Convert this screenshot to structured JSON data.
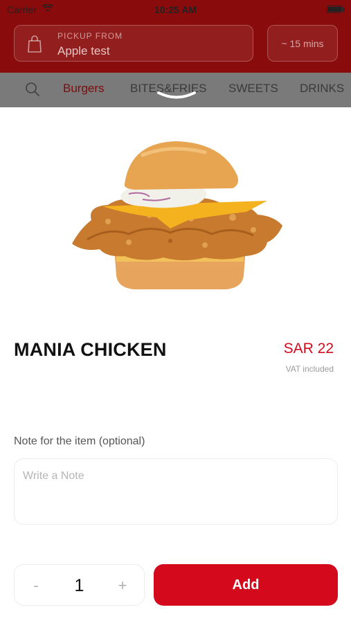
{
  "status_bar": {
    "carrier": "Carrier",
    "time": "10:25 AM"
  },
  "header": {
    "pickup_label": "PICKUP FROM",
    "pickup_value": "Apple test",
    "eta": "~ 15 mins",
    "icons": {
      "bag": "shopping-bag-icon"
    }
  },
  "categories": {
    "search_icon": "search-icon",
    "tabs": [
      {
        "label": "Burgers",
        "active": true
      },
      {
        "label": "BITES&FRIES",
        "active": false
      },
      {
        "label": "SWEETS",
        "active": false
      },
      {
        "label": "DRINKS",
        "active": false
      }
    ]
  },
  "product": {
    "name": "MANIA CHICKEN",
    "price": "SAR 22",
    "vat_note": "VAT included"
  },
  "note": {
    "label": "Note for the item (optional)",
    "placeholder": "Write a Note",
    "value": ""
  },
  "order": {
    "minus": "-",
    "quantity": "1",
    "plus": "+",
    "add_label": "Add"
  },
  "colors": {
    "header_bg": "#8a0b0b",
    "accent": "#d4091c",
    "overlay_gray": "#7a7a7a"
  }
}
